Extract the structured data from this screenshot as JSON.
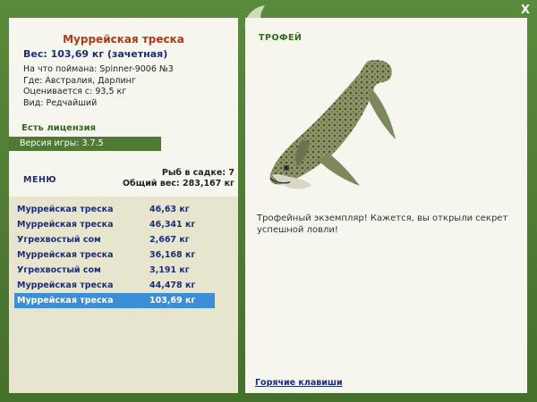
{
  "window": {
    "close_glyph": "X"
  },
  "fish": {
    "title": "Муррейская треска",
    "weight_line": "Вес: 103,69 кг (зачетная)",
    "details": [
      "На что поймана: Spinner-9006 №3",
      "Где: Австралия, Дарлинг",
      "Оценивается с: 93,5 кг",
      "Вид: Редчайший"
    ]
  },
  "license": "Есть лицензия",
  "version": "Версия игры: 3.7.5",
  "menu_label": "МЕНЮ",
  "cage": {
    "count": "Рыб в садке: 7",
    "total": "Общий вес: 283,167 кг"
  },
  "catches": [
    {
      "name": "Муррейская треска",
      "weight": "46,63 кг",
      "selected": false
    },
    {
      "name": "Муррейская треска",
      "weight": "46,341 кг",
      "selected": false
    },
    {
      "name": "Угрехвостый сом",
      "weight": "2,667 кг",
      "selected": false
    },
    {
      "name": "Муррейская треска",
      "weight": "36,168 кг",
      "selected": false
    },
    {
      "name": "Угрехвостый сом",
      "weight": "3,191 кг",
      "selected": false
    },
    {
      "name": "Муррейская треска",
      "weight": "44,478 кг",
      "selected": false
    },
    {
      "name": "Муррейская треска",
      "weight": "103,69 кг",
      "selected": true
    }
  ],
  "trophy": {
    "label": "ТРОФЕЙ",
    "text": "Трофейный экземпляр! Кажется, вы открыли секрет успешной ловли!"
  },
  "hotkeys": "Горячие клавиши",
  "colors": {
    "frame": "#4e7a33",
    "panel": "#f7f6ee",
    "selection": "#3b8fd6",
    "title": "#b03a12"
  },
  "icons": [
    "logo-icon",
    "close-icon",
    "fish-trophy-image"
  ]
}
